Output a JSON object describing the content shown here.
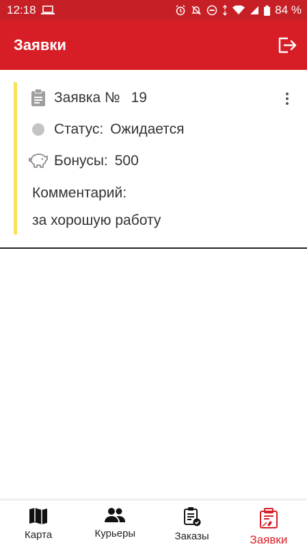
{
  "status_bar": {
    "time": "12:18",
    "battery": "84 %"
  },
  "app_bar": {
    "title": "Заявки"
  },
  "request": {
    "number_label": "Заявка №",
    "number": "19",
    "status_label": "Статус:",
    "status_value": "Ожидается",
    "bonus_label": "Бонусы:",
    "bonus_value": "500",
    "comment_label": "Комментарий:",
    "comment_text": "за хорошую работу",
    "accent_color": "#f5e35a"
  },
  "bottom_nav": {
    "items": [
      {
        "label": "Карта",
        "icon": "map-icon"
      },
      {
        "label": "Курьеры",
        "icon": "people-icon"
      },
      {
        "label": "Заказы",
        "icon": "orders-checklist-icon"
      },
      {
        "label": "Заявки",
        "icon": "requests-icon"
      }
    ],
    "active": "Заявки"
  },
  "colors": {
    "primary": "#d71e26",
    "status_bar": "#c62026",
    "active_tab": "#d71e26"
  }
}
